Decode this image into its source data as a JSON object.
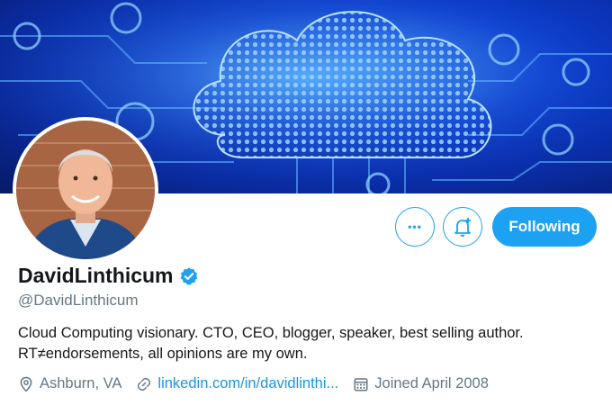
{
  "profile": {
    "display_name": "DavidLinthicum",
    "handle": "@DavidLinthicum",
    "bio_line1": "Cloud Computing visionary. CTO, CEO, blogger, speaker, best selling author.",
    "bio_line2": "RT≠endorsements, all opinions are my own.",
    "location": "Ashburn, VA",
    "website": "linkedin.com/in/davidlinthi...",
    "joined": "Joined April 2008",
    "verified": true
  },
  "actions": {
    "more_label": "•••",
    "follow_label": "Following"
  },
  "icons": {
    "more": "more-icon",
    "notifications": "bell-plus-icon",
    "verified": "verified-badge-icon",
    "location": "location-pin-icon",
    "link": "link-icon",
    "calendar": "calendar-icon"
  },
  "colors": {
    "accent": "#1da1f2",
    "text": "#14171a",
    "secondary": "#657786",
    "link": "#1b95e0"
  }
}
